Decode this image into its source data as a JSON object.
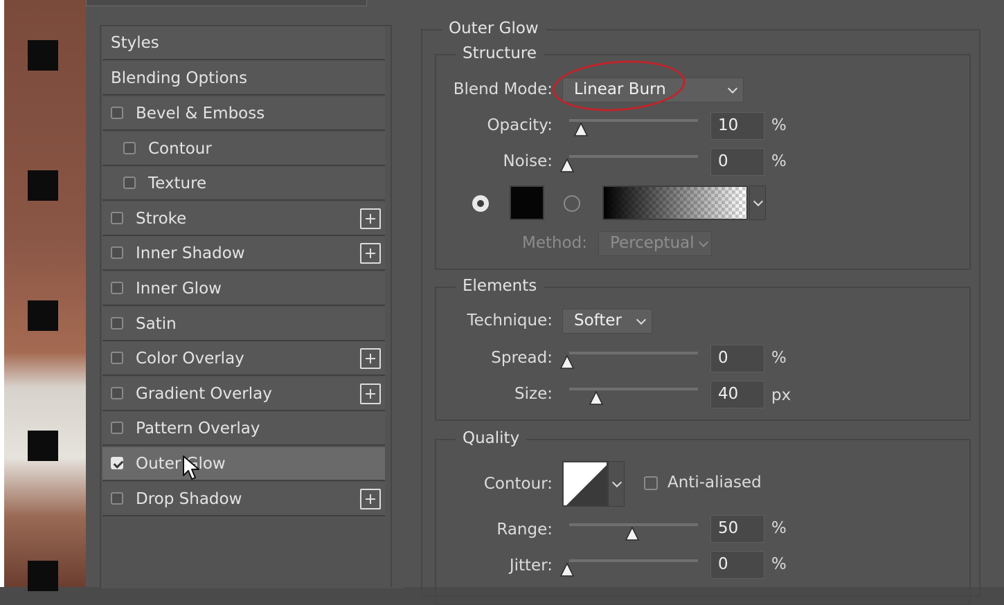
{
  "styles_panel": {
    "header_styles": "Styles",
    "header_blending": "Blending Options",
    "items": [
      {
        "label": "Bevel & Emboss",
        "checked": false,
        "indent": false,
        "plus": false
      },
      {
        "label": "Contour",
        "checked": false,
        "indent": true,
        "plus": false
      },
      {
        "label": "Texture",
        "checked": false,
        "indent": true,
        "plus": false
      },
      {
        "label": "Stroke",
        "checked": false,
        "indent": false,
        "plus": true
      },
      {
        "label": "Inner Shadow",
        "checked": false,
        "indent": false,
        "plus": true
      },
      {
        "label": "Inner Glow",
        "checked": false,
        "indent": false,
        "plus": false
      },
      {
        "label": "Satin",
        "checked": false,
        "indent": false,
        "plus": false
      },
      {
        "label": "Color Overlay",
        "checked": false,
        "indent": false,
        "plus": true
      },
      {
        "label": "Gradient Overlay",
        "checked": false,
        "indent": false,
        "plus": true
      },
      {
        "label": "Pattern Overlay",
        "checked": false,
        "indent": false,
        "plus": false
      },
      {
        "label": "Outer Glow",
        "checked": true,
        "indent": false,
        "plus": false
      },
      {
        "label": "Drop Shadow",
        "checked": false,
        "indent": false,
        "plus": true
      }
    ]
  },
  "outer_glow": {
    "title": "Outer Glow",
    "structure": {
      "title": "Structure",
      "blend_mode_label": "Blend Mode:",
      "blend_mode_value": "Linear Burn",
      "opacity_label": "Opacity:",
      "opacity_value": "10",
      "opacity_unit": "%",
      "noise_label": "Noise:",
      "noise_value": "0",
      "noise_unit": "%",
      "method_label": "Method:",
      "method_value": "Perceptual",
      "color_swatch": "#050505"
    },
    "elements": {
      "title": "Elements",
      "technique_label": "Technique:",
      "technique_value": "Softer",
      "spread_label": "Spread:",
      "spread_value": "0",
      "spread_unit": "%",
      "size_label": "Size:",
      "size_value": "40",
      "size_unit": "px"
    },
    "quality": {
      "title": "Quality",
      "contour_label": "Contour:",
      "anti_aliased_label": "Anti-aliased",
      "range_label": "Range:",
      "range_value": "50",
      "range_unit": "%",
      "jitter_label": "Jitter:",
      "jitter_value": "0",
      "jitter_unit": "%"
    }
  },
  "colors": {
    "annotation_red": "#c0242a",
    "panel_bg": "#535353",
    "selected_row": "#6a6a6a"
  }
}
